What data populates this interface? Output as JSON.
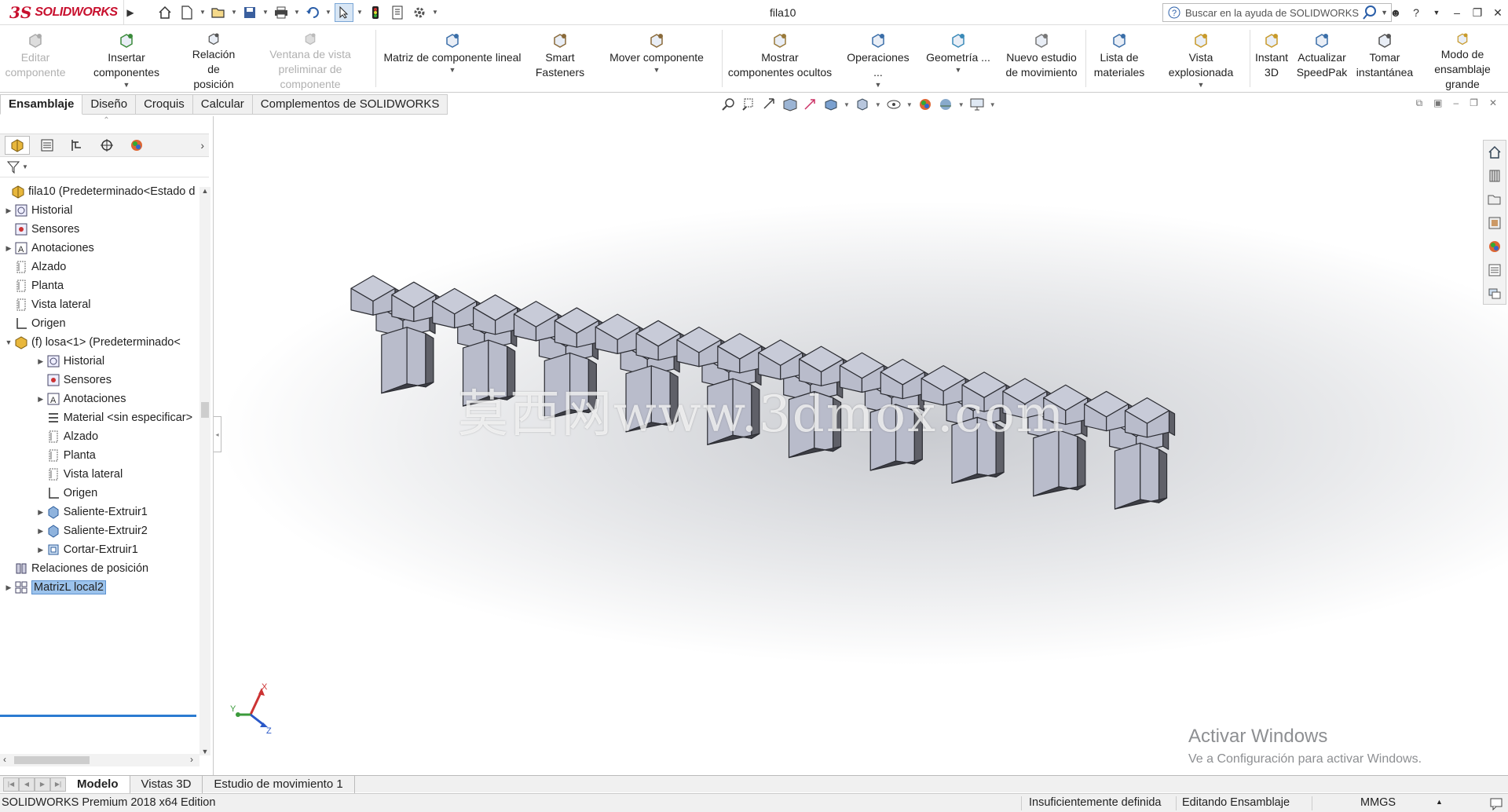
{
  "app": {
    "logo_ds": "3S",
    "logo_text": "SOLIDWORKS",
    "document_title": "fila10",
    "search_placeholder": "Buscar en la ayuda de SOLIDWORKS"
  },
  "ribbon": {
    "buttons": [
      {
        "label1": "Editar",
        "label2": "componente",
        "disabled": true
      },
      {
        "label1": "Insertar componentes",
        "label2": "",
        "caret": true
      },
      {
        "label1": "Relación de",
        "label2": "posición"
      },
      {
        "label1": "Ventana de vista",
        "label2": "preliminar de componente",
        "disabled": true
      },
      {
        "label1": "Matriz de componente lineal",
        "label2": "",
        "caret": true
      },
      {
        "label1": "Smart",
        "label2": "Fasteners"
      },
      {
        "label1": "Mover componente",
        "label2": "",
        "caret": true
      },
      {
        "label1": "Mostrar",
        "label2": "componentes ocultos"
      },
      {
        "label1": "Operaciones ...",
        "label2": "",
        "caret": true
      },
      {
        "label1": "Geometría ...",
        "label2": "",
        "caret": true
      },
      {
        "label1": "Nuevo estudio",
        "label2": "de movimiento"
      },
      {
        "label1": "Lista de",
        "label2": "materiales"
      },
      {
        "label1": "Vista explosionada",
        "label2": "",
        "caret": true
      },
      {
        "label1": "Instant",
        "label2": "3D"
      },
      {
        "label1": "Actualizar",
        "label2": "SpeedPak"
      },
      {
        "label1": "Tomar",
        "label2": "instantánea"
      },
      {
        "label1": "Modo de",
        "label2": "ensamblaje grande"
      }
    ]
  },
  "cm_tabs": [
    "Ensamblaje",
    "Diseño",
    "Croquis",
    "Calcular",
    "Complementos de SOLIDWORKS"
  ],
  "tree": {
    "root": "fila10  (Predeterminado<Estado d",
    "items": [
      {
        "label": "Historial",
        "level": 1,
        "expand": "collapsed",
        "icon": "history-icon"
      },
      {
        "label": "Sensores",
        "level": 1,
        "expand": "none",
        "icon": "sensor-icon"
      },
      {
        "label": "Anotaciones",
        "level": 1,
        "expand": "collapsed",
        "icon": "annotation-icon"
      },
      {
        "label": "Alzado",
        "level": 1,
        "expand": "none",
        "icon": "plane-icon"
      },
      {
        "label": "Planta",
        "level": 1,
        "expand": "none",
        "icon": "plane-icon"
      },
      {
        "label": "Vista lateral",
        "level": 1,
        "expand": "none",
        "icon": "plane-icon"
      },
      {
        "label": "Origen",
        "level": 1,
        "expand": "none",
        "icon": "origin-icon"
      },
      {
        "label": "(f) losa<1> (Predeterminado<",
        "level": 1,
        "expand": "expanded",
        "icon": "part-icon"
      },
      {
        "label": "Historial",
        "level": 2,
        "expand": "collapsed",
        "icon": "history-icon"
      },
      {
        "label": "Sensores",
        "level": 2,
        "expand": "none",
        "icon": "sensor-icon"
      },
      {
        "label": "Anotaciones",
        "level": 2,
        "expand": "collapsed",
        "icon": "annotation-icon"
      },
      {
        "label": "Material <sin especificar>",
        "level": 2,
        "expand": "none",
        "icon": "material-icon"
      },
      {
        "label": "Alzado",
        "level": 2,
        "expand": "none",
        "icon": "plane-icon"
      },
      {
        "label": "Planta",
        "level": 2,
        "expand": "none",
        "icon": "plane-icon"
      },
      {
        "label": "Vista lateral",
        "level": 2,
        "expand": "none",
        "icon": "plane-icon"
      },
      {
        "label": "Origen",
        "level": 2,
        "expand": "none",
        "icon": "origin-icon"
      },
      {
        "label": "Saliente-Extruir1",
        "level": 2,
        "expand": "collapsed",
        "icon": "extrude-icon"
      },
      {
        "label": "Saliente-Extruir2",
        "level": 2,
        "expand": "collapsed",
        "icon": "extrude-icon"
      },
      {
        "label": "Cortar-Extruir1",
        "level": 2,
        "expand": "collapsed",
        "icon": "cut-icon"
      },
      {
        "label": "Relaciones de posición",
        "level": 1,
        "expand": "none",
        "icon": "mates-icon"
      },
      {
        "label": "MatrizL local2",
        "level": 1,
        "expand": "collapsed",
        "icon": "pattern-icon",
        "selected": true
      }
    ]
  },
  "graphics": {
    "watermark": "莫西网www.3dmox.com",
    "activate_title": "Activar Windows",
    "activate_sub": "Ve a Configuración para activar Windows.",
    "triad_x": "X",
    "triad_y": "Y",
    "triad_z": "Z",
    "pattern_instances": 20
  },
  "bottom_tabs": [
    "Modelo",
    "Vistas 3D",
    "Estudio de movimiento 1"
  ],
  "status": {
    "edition": "SOLIDWORKS Premium 2018 x64 Edition",
    "definition": "Insuficientemente definida",
    "mode": "Editando Ensamblaje",
    "units": "MMGS"
  },
  "colors": {
    "brand": "#c8102e",
    "selection": "#9cc3ec",
    "model_face": "#b9bccb"
  }
}
